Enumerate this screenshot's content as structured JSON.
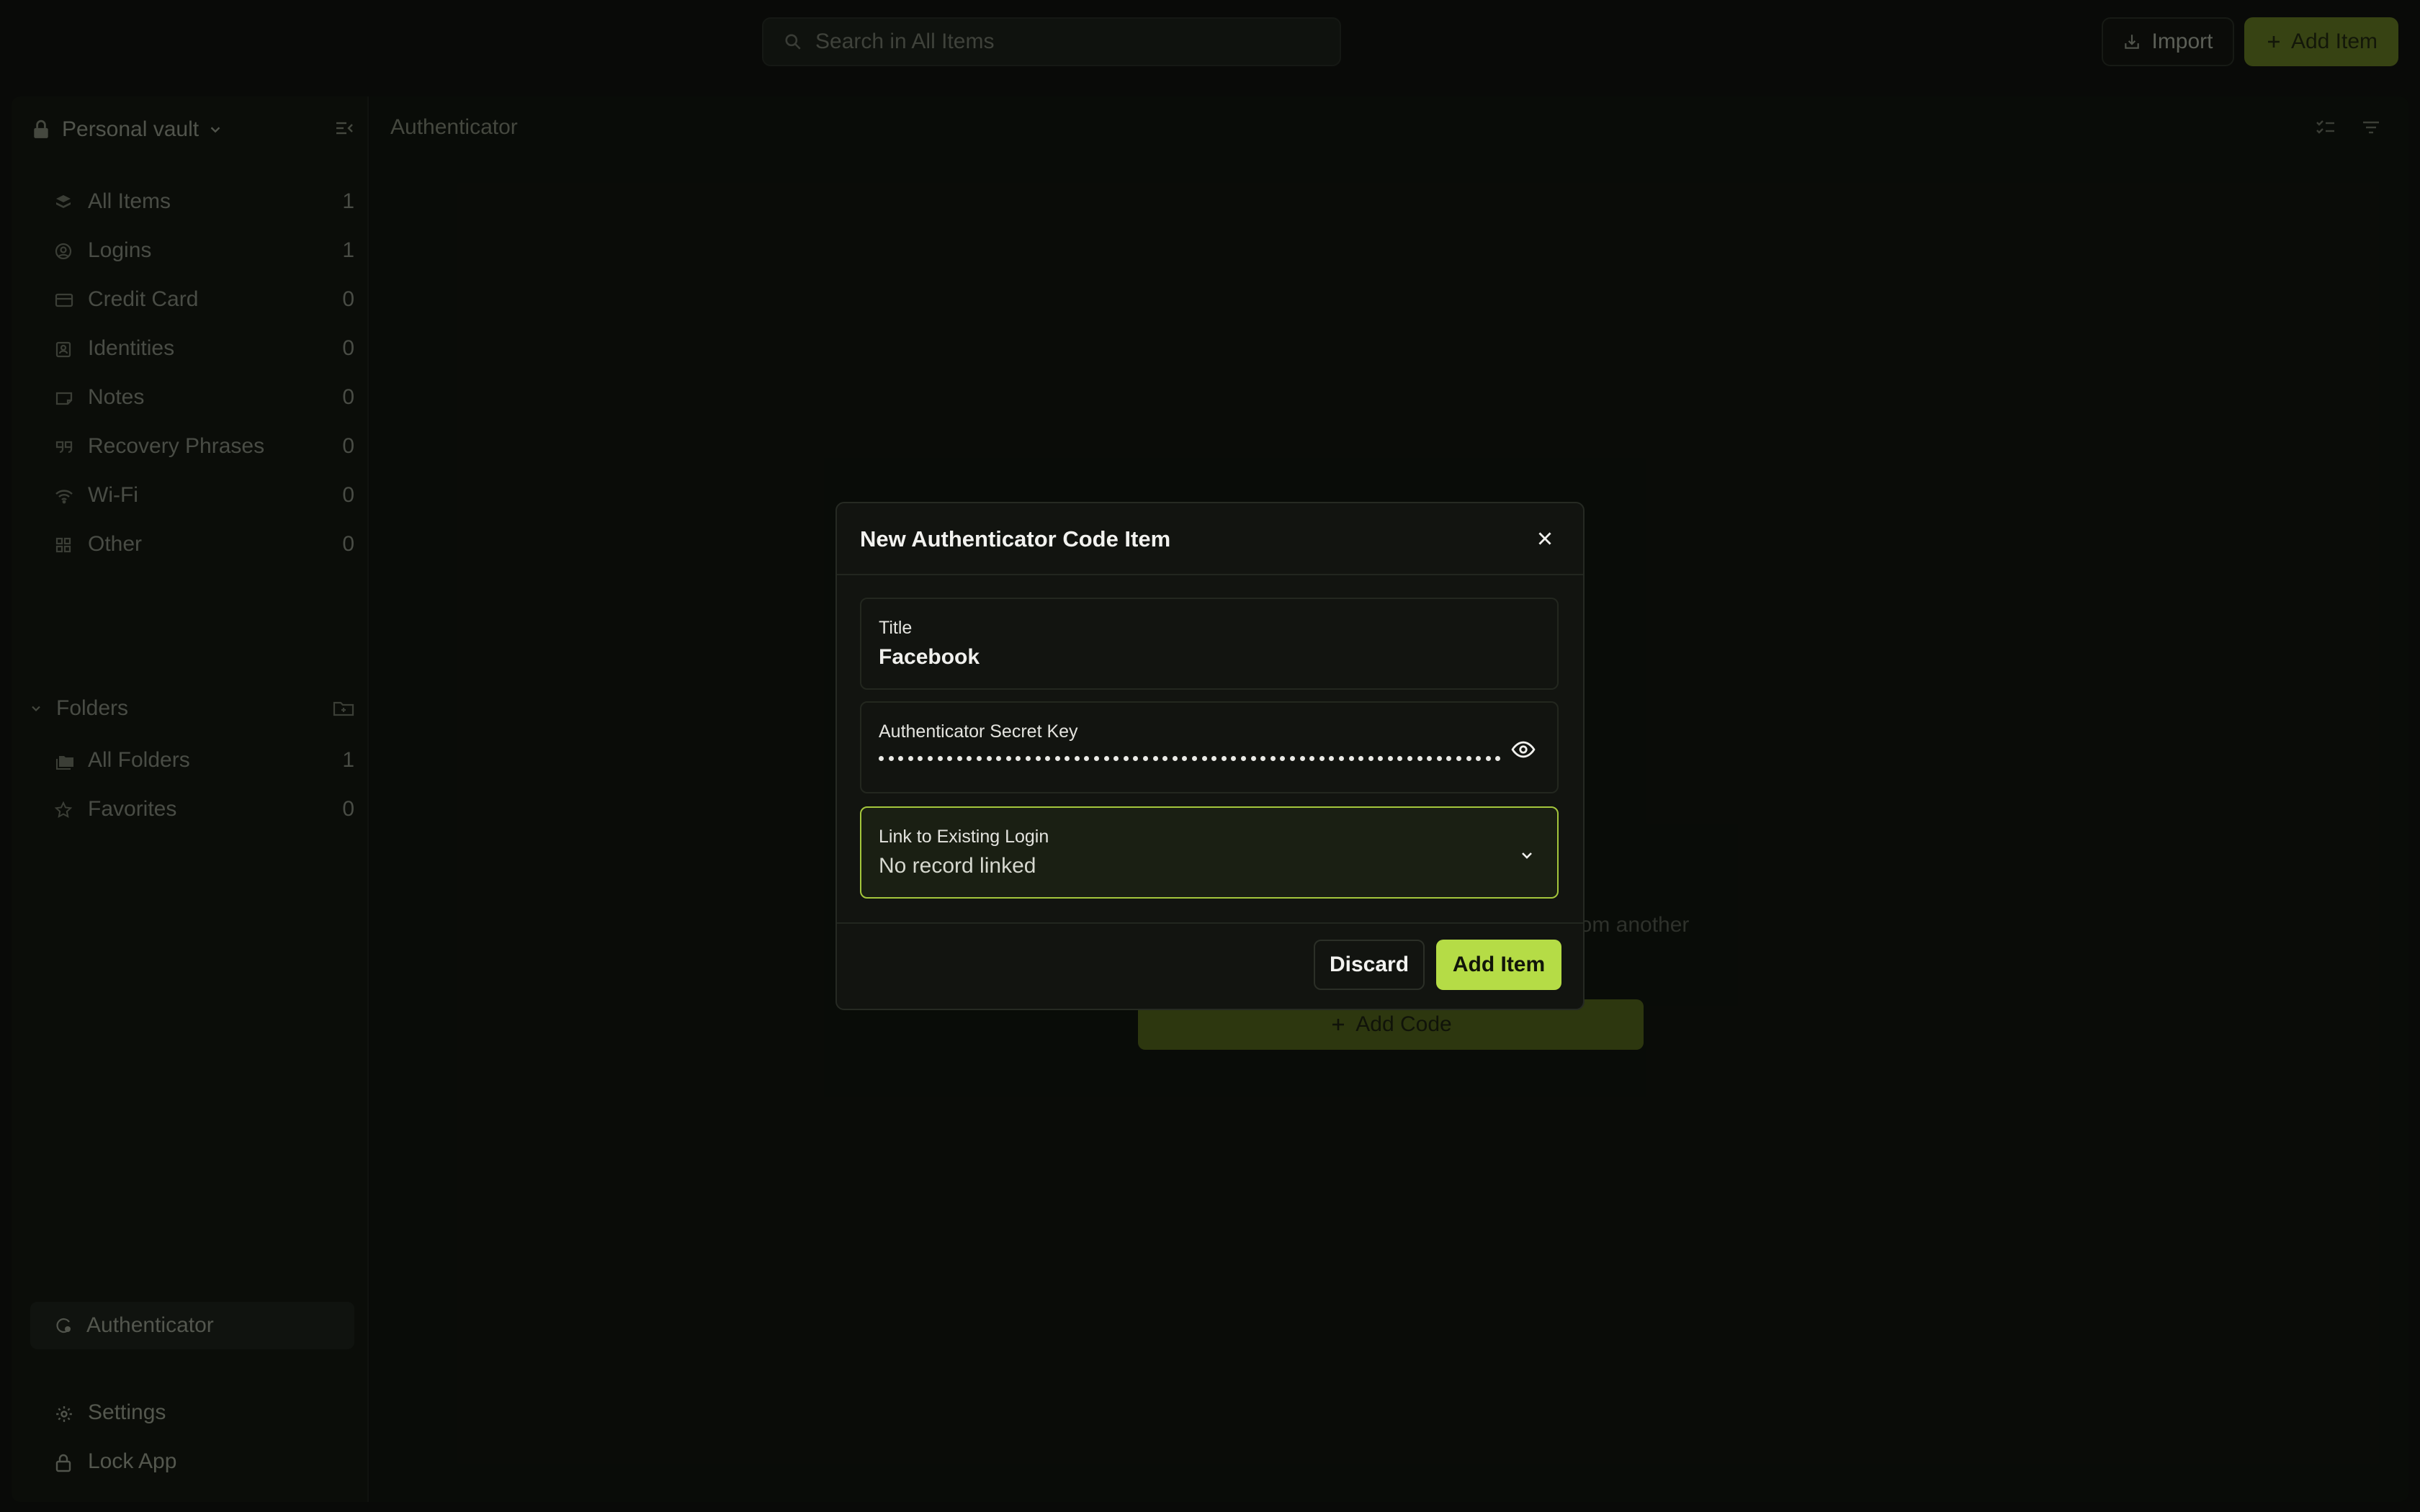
{
  "search": {
    "placeholder": "Search in All Items"
  },
  "topbar": {
    "import_label": "Import",
    "add_item_label": "Add Item"
  },
  "sidebar": {
    "vault_name": "Personal vault",
    "items": [
      {
        "label": "All Items",
        "count": "1",
        "icon": "layers-icon"
      },
      {
        "label": "Logins",
        "count": "1",
        "icon": "user-circle-icon"
      },
      {
        "label": "Credit Card",
        "count": "0",
        "icon": "credit-card-icon"
      },
      {
        "label": "Identities",
        "count": "0",
        "icon": "id-badge-icon"
      },
      {
        "label": "Notes",
        "count": "0",
        "icon": "note-icon"
      },
      {
        "label": "Recovery Phrases",
        "count": "0",
        "icon": "quote-icon"
      },
      {
        "label": "Wi-Fi",
        "count": "0",
        "icon": "wifi-icon"
      },
      {
        "label": "Other",
        "count": "0",
        "icon": "grid-icon"
      }
    ],
    "folders_label": "Folders",
    "folders": [
      {
        "label": "All Folders",
        "count": "1",
        "icon": "folders-icon"
      },
      {
        "label": "Favorites",
        "count": "0",
        "icon": "star-icon"
      }
    ],
    "authenticator_label": "Authenticator",
    "settings_label": "Settings",
    "lock_label": "Lock App"
  },
  "main": {
    "title": "Authenticator",
    "empty_text": "s from another",
    "add_code_label": "Add Code"
  },
  "modal": {
    "title": "New Authenticator Code Item",
    "title_field_label": "Title",
    "title_field_value": "Facebook",
    "secret_field_label": "Authenticator Secret Key",
    "link_field_label": "Link to Existing Login",
    "link_field_value": "No record linked",
    "discard_label": "Discard",
    "add_label": "Add Item"
  },
  "colors": {
    "accent": "#b5dc46",
    "background": "#0c0e0b",
    "muted_accent": "#4a5a1a"
  }
}
